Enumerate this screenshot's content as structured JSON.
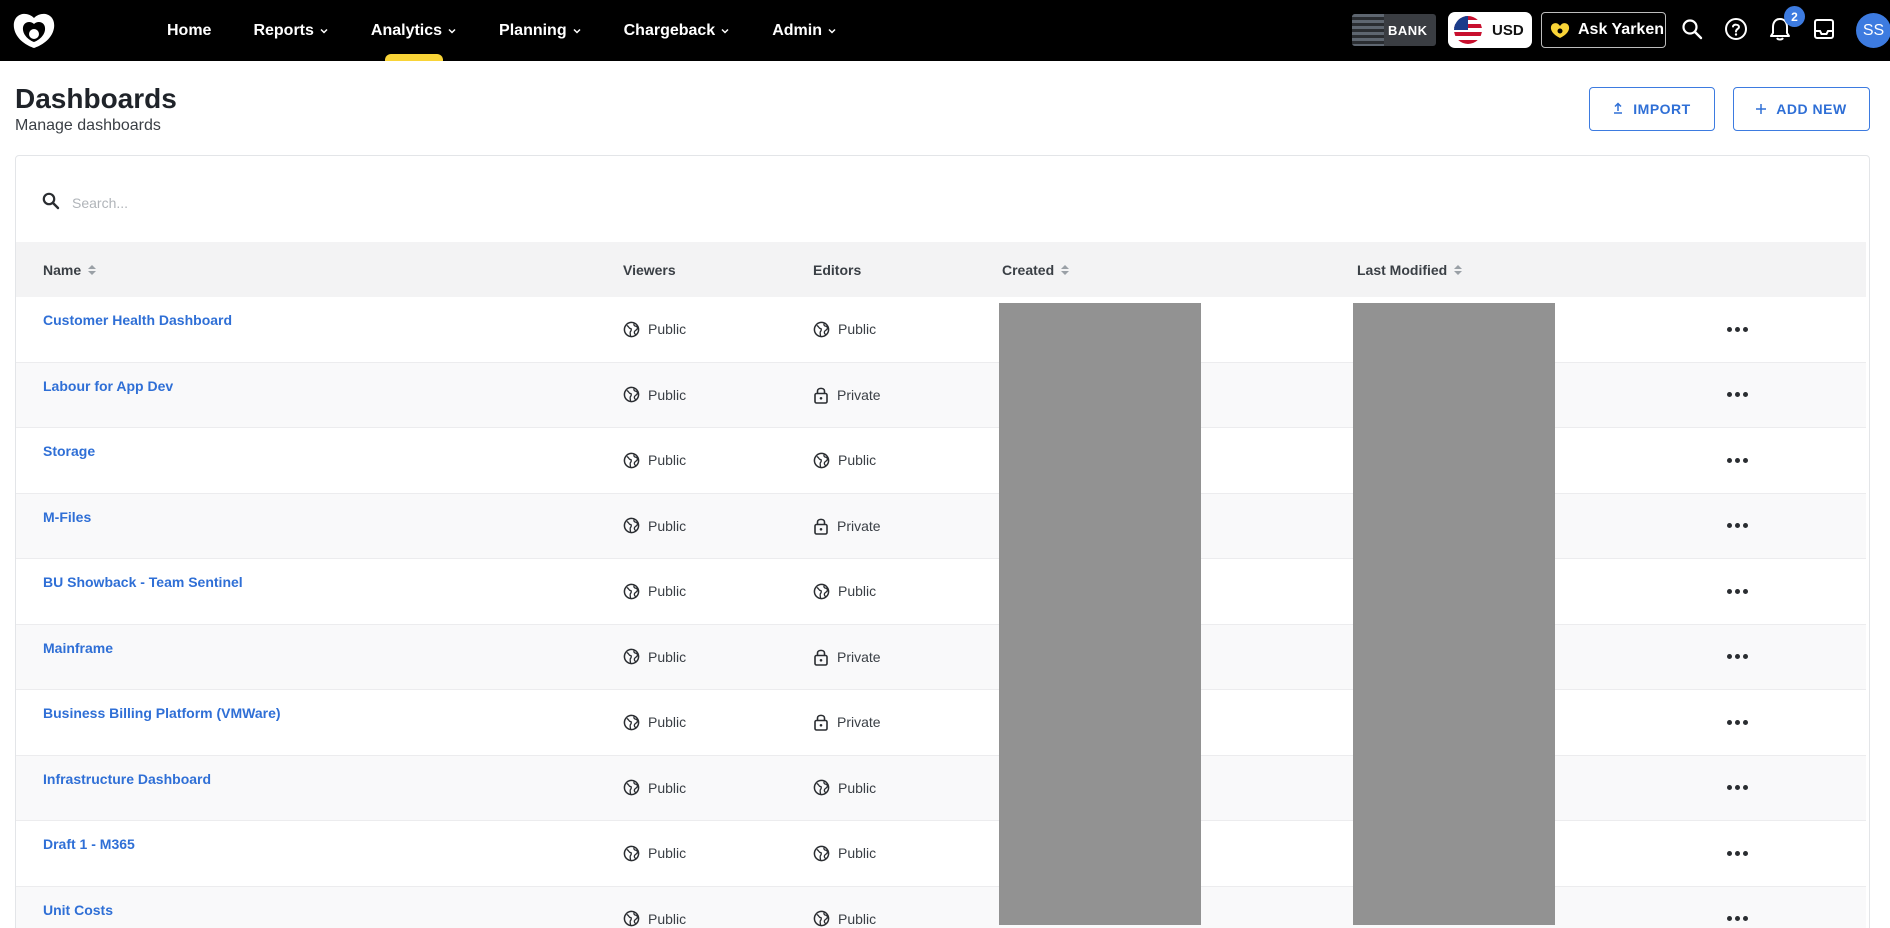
{
  "nav": {
    "items": [
      {
        "label": "Home",
        "dropdown": false,
        "active": false
      },
      {
        "label": "Reports",
        "dropdown": true,
        "active": false
      },
      {
        "label": "Analytics",
        "dropdown": true,
        "active": true
      },
      {
        "label": "Planning",
        "dropdown": true,
        "active": false
      },
      {
        "label": "Chargeback",
        "dropdown": true,
        "active": false
      },
      {
        "label": "Admin",
        "dropdown": true,
        "active": false
      }
    ],
    "bank_logo_text": "BANK",
    "currency": "USD",
    "ask_label": "Ask Yarken",
    "notification_count": "2",
    "avatar_initials": "SS",
    "accent_color": "#f9d437"
  },
  "header": {
    "title": "Dashboards",
    "subtitle": "Manage dashboards",
    "import_label": "IMPORT",
    "add_new_label": "ADD NEW"
  },
  "search": {
    "placeholder": "Search...",
    "value": ""
  },
  "table": {
    "columns": {
      "name": "Name",
      "viewers": "Viewers",
      "editors": "Editors",
      "created": "Created",
      "last_modified": "Last Modified"
    },
    "rows": [
      {
        "name": "Customer Health Dashboard",
        "viewers": "Public",
        "editors": "Public"
      },
      {
        "name": "Labour for App Dev",
        "viewers": "Public",
        "editors": "Private"
      },
      {
        "name": "Storage",
        "viewers": "Public",
        "editors": "Public"
      },
      {
        "name": "M-Files",
        "viewers": "Public",
        "editors": "Private"
      },
      {
        "name": "BU Showback - Team Sentinel",
        "viewers": "Public",
        "editors": "Public"
      },
      {
        "name": "Mainframe",
        "viewers": "Public",
        "editors": "Private"
      },
      {
        "name": "Business Billing Platform (VMWare)",
        "viewers": "Public",
        "editors": "Private"
      },
      {
        "name": "Infrastructure Dashboard",
        "viewers": "Public",
        "editors": "Public"
      },
      {
        "name": "Draft 1 - M365",
        "viewers": "Public",
        "editors": "Public"
      },
      {
        "name": "Unit Costs",
        "viewers": "Public",
        "editors": "Public"
      }
    ]
  }
}
